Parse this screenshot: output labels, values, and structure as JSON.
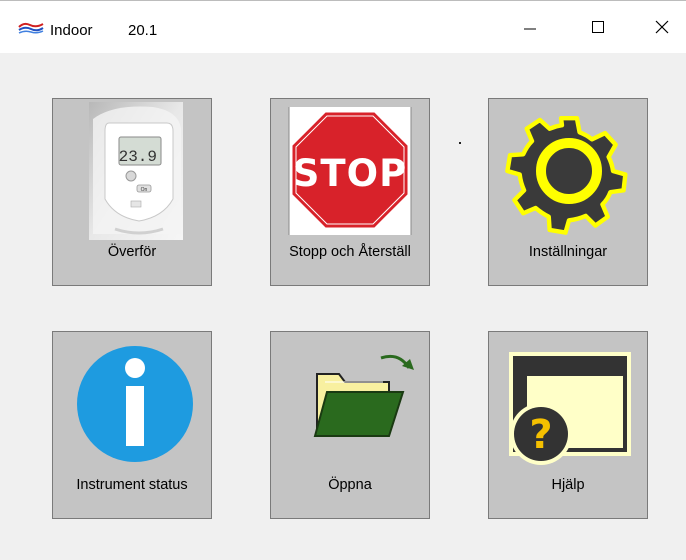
{
  "window": {
    "title": "Indoor",
    "version": "20.1",
    "controls": {
      "minimize_icon": "minimize-icon",
      "maximize_icon": "maximize-icon",
      "close_icon": "close-icon"
    }
  },
  "tiles": [
    {
      "label": "Överför",
      "icon": "device-transfer-icon"
    },
    {
      "label": "Stopp och Återställ",
      "icon": "stop-sign-icon",
      "sign_text": "STOP"
    },
    {
      "label": "Inställningar",
      "icon": "gear-icon"
    },
    {
      "label": "Instrument status",
      "icon": "info-icon"
    },
    {
      "label": "Öppna",
      "icon": "open-folder-icon"
    },
    {
      "label": "Hjälp",
      "icon": "help-window-icon"
    }
  ],
  "device": {
    "display_value": "23.9",
    "button_label": "On"
  },
  "colors": {
    "tile_bg": "#c4c4c4",
    "stop_red": "#d8222a",
    "gear_yellow": "#ffff00",
    "gear_dark": "#3a3a3a",
    "info_blue": "#1e9be0",
    "folder_green": "#2a6a1e",
    "help_cream": "#ffffc8"
  }
}
